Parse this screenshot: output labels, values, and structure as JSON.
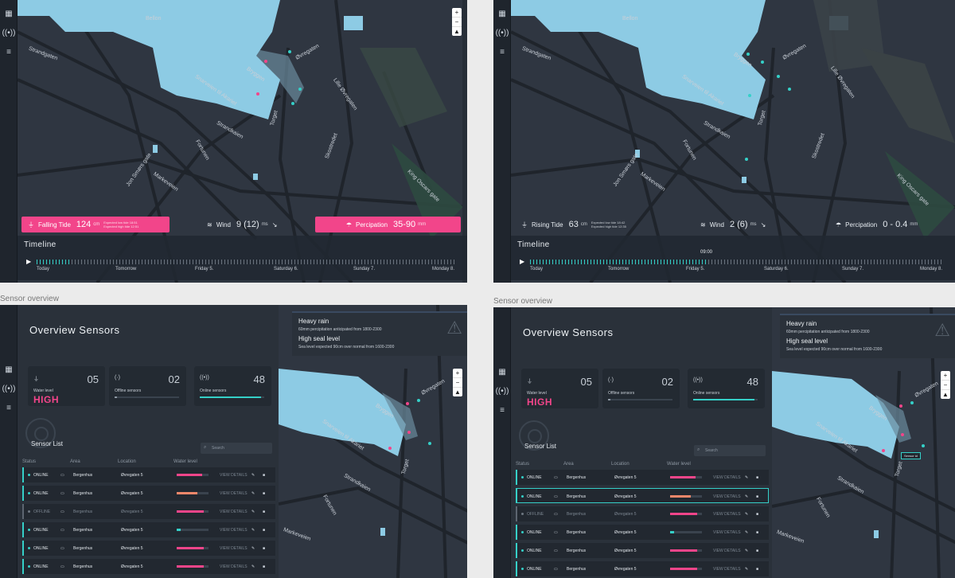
{
  "screens": {
    "timeline_falling": {
      "tide": {
        "label": "Falling Tide",
        "value": "124",
        "unit": "cm",
        "note1": "Expected low tide 18:51",
        "note2": "Expected high tide 12:51"
      },
      "wind": {
        "label": "Wind",
        "value": "9 (12)",
        "unit": "ms"
      },
      "precip": {
        "label": "Percipation",
        "value": "35-90",
        "unit": "mm"
      },
      "timeline": {
        "title": "Timeline",
        "days": [
          "Today",
          "Tomorrow",
          "Friday 5.",
          "Saturday 6.",
          "Sunday 7.",
          "Monday 8."
        ],
        "progress": 0.08
      }
    },
    "timeline_rising": {
      "tide": {
        "label": "Rising Tide",
        "value": "63",
        "unit": "cm",
        "note1": "Expected low tide 18:42",
        "note2": "Expected high tide 12:35"
      },
      "wind": {
        "label": "Wind",
        "value": "2 (6)",
        "unit": "ms"
      },
      "precip": {
        "label": "Percipation",
        "value": "0 - 0.4",
        "unit": "mm"
      },
      "timeline": {
        "title": "Timeline",
        "cursor": "09:00",
        "days": [
          "Today",
          "Tomorrow",
          "Friday 5.",
          "Saturday 6.",
          "Sunday 7.",
          "Monday 8."
        ],
        "progress": 0.43
      }
    }
  },
  "captions": {
    "left": "Sensor overview",
    "right": "Sensor overview"
  },
  "map_labels": {
    "bryggen": "Bryggen",
    "ovregaten": "Øvregaten",
    "strandgaten": "Strandgaten",
    "markeveien": "Markeveien",
    "torget": "Torget",
    "strandkaien": "Strandkaien",
    "fortunen": "Fortunen",
    "smorsgate": "Jon Smørs gate",
    "kingoscar": "King Oscars gate",
    "akariet": "Snarveien til Akariet",
    "lille": "Lille Øvregaten",
    "skostredet": "Skostredet",
    "fjellsien": "Fjellsien",
    "bredsgate": "Bredsgate",
    "bellon": "Bellon"
  },
  "overview": {
    "title": "Overview Sensors",
    "cards": {
      "water": {
        "num": "05",
        "label": "Water level",
        "status": "HIGH"
      },
      "offline": {
        "num": "02",
        "label": "Offline sensors",
        "bar": 0.04
      },
      "online": {
        "num": "48",
        "label": "Online sensors",
        "bar": 0.95
      }
    },
    "sensor_list_title": "Sensor List",
    "search_placeholder": "Search",
    "columns": [
      "Status",
      "Area",
      "Location",
      "Water level"
    ],
    "rows": [
      {
        "status": "ONLINE",
        "area": "Bergenhus",
        "location": "Øvregaten 5",
        "action": "VIEW DETAILS",
        "level": 0.8,
        "color": "#f2458a"
      },
      {
        "status": "ONLINE",
        "area": "Bergenhus",
        "location": "Øvregaten 5",
        "action": "VIEW DETAILS",
        "level": 0.65,
        "color": "#f0876a"
      },
      {
        "status": "OFFLINE",
        "area": "Bergenhus",
        "location": "Øvregaten 5",
        "action": "VIEW DETAILS",
        "level": 0.85,
        "color": "#f2458a"
      },
      {
        "status": "ONLINE",
        "area": "Bergenhus",
        "location": "Øvregaten 5",
        "action": "VIEW DETAILS",
        "level": 0.12,
        "color": "#35d0c8"
      },
      {
        "status": "ONLINE",
        "area": "Bergenhus",
        "location": "Øvregaten 5",
        "action": "VIEW DETAILS",
        "level": 0.85,
        "color": "#f2458a"
      },
      {
        "status": "ONLINE",
        "area": "Bergenhus",
        "location": "Øvregaten 5",
        "action": "VIEW DETAILS",
        "level": 0.85,
        "color": "#f2458a"
      }
    ],
    "alert": {
      "t1": "Heavy rain",
      "t2": "60mm percipitation anticipated from 1800-2300",
      "t3": "High seal level",
      "t4": "Sea level expected 90cm over normal from 1600-2300"
    },
    "tooltip": "Sensor id"
  },
  "colors": {
    "accent": "#35d0c8",
    "alert": "#f2458a",
    "water": "#8dcbe4"
  }
}
